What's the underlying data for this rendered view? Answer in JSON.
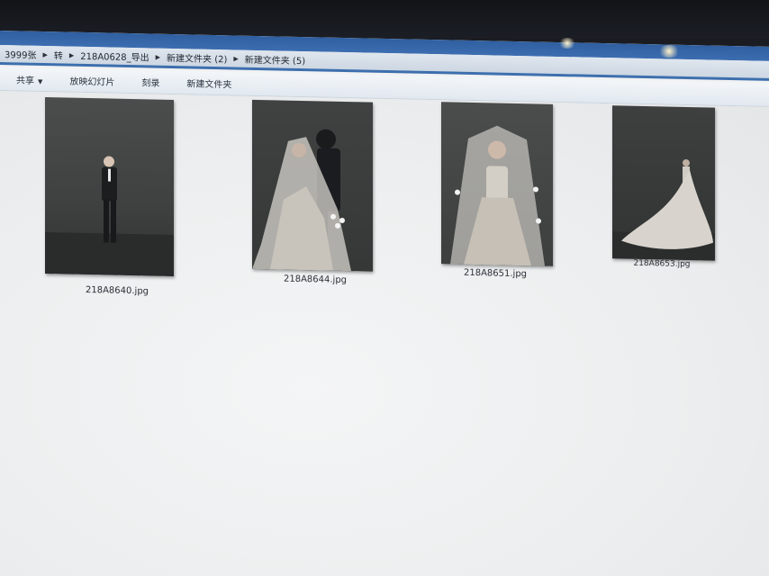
{
  "breadcrumb": [
    {
      "label": "3999张"
    },
    {
      "label": "转"
    },
    {
      "label": "218A0628_导出"
    },
    {
      "label": "新建文件夹 (2)"
    },
    {
      "label": "新建文件夹 (5)"
    }
  ],
  "toolbar": {
    "share_label": "共享",
    "slideshow_label": "放映幻灯片",
    "burn_label": "刻录",
    "new_folder_label": "新建文件夹"
  },
  "files": [
    {
      "name": "218A8640.jpg",
      "icon": "photo-groom-standing"
    },
    {
      "name": "218A8644.jpg",
      "icon": "photo-couple-veil"
    },
    {
      "name": "218A8651.jpg",
      "icon": "photo-bride-veil"
    },
    {
      "name": "218A8653.jpg",
      "icon": "photo-bride-train"
    }
  ],
  "colors": {
    "window_accent": "#3d6fae",
    "background": "#eceeef"
  }
}
